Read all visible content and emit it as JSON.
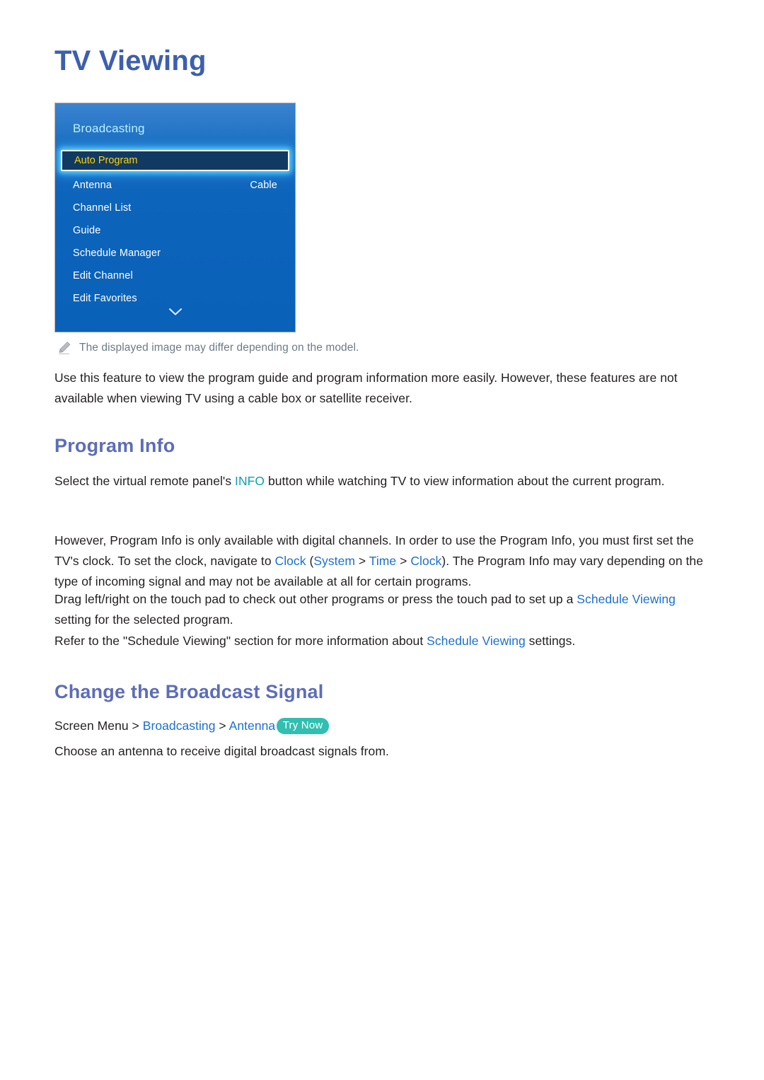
{
  "document": {
    "title": "TV Viewing"
  },
  "tv_menu": {
    "panel_title": "Broadcasting",
    "selected_item": "Auto Program",
    "items": [
      {
        "label": "Antenna",
        "value": "Cable"
      },
      {
        "label": "Channel List",
        "value": ""
      },
      {
        "label": "Guide",
        "value": ""
      },
      {
        "label": "Schedule Manager",
        "value": ""
      },
      {
        "label": "Edit Channel",
        "value": ""
      },
      {
        "label": "Edit Favorites",
        "value": ""
      }
    ],
    "scroll_down_icon": "chevron-down-icon",
    "colors": {
      "panel_gradient_top": "#3a83d0",
      "panel_gradient_bottom": "#0a61b8",
      "panel_title_text": "#b9f0ff",
      "selected_fill": "#113a63",
      "selected_text": "#ffd200",
      "selected_glow": "#5ad2ff"
    }
  },
  "note": {
    "icon": "pencil-icon",
    "text": "The displayed image may differ depending on the model."
  },
  "intro": {
    "line1": "Use this feature to view the program guide and program information more easily. However, these",
    "line2": "features are not available when viewing TV using a cable box or satellite receiver."
  },
  "program_info": {
    "heading": "Program Info",
    "p1_before": "Select the virtual remote panel's ",
    "p1_link": "INFO",
    "p1_after": " button while watching TV to view information about the current program.",
    "p2_before": "However, Program Info is only available with digital channels. In order to use the Program Info, you must first set the TV's clock. To set the clock, navigate to ",
    "p2_link_clock": "Clock",
    "p2_paren_open": " (",
    "p2_link_system": "System",
    "p2_sep_1": " > ",
    "p2_link_time": "Time",
    "p2_sep_2": " > ",
    "p2_link_clock2": "Clock",
    "p2_paren_close": ")",
    "p2_after": ". The Program Info may vary depending on the type of incoming signal and may not be available at all for certain programs.",
    "p3_before": "Drag left/right on the touch pad to check out other programs or press the touch pad to set up a ",
    "p3_link": "Schedule Viewing",
    "p3_after": " setting for the selected program.",
    "p4_before": "Refer to the \"Schedule Viewing\" section for more information about ",
    "p4_link": "Schedule Viewing",
    "p4_after": " settings."
  },
  "change_broadcast_signal": {
    "heading": "Change the Broadcast Signal",
    "breadcrumb_root": "Screen Menu",
    "breadcrumb_sep_1": " > ",
    "breadcrumb_item_1": "Broadcasting",
    "breadcrumb_sep_2": " > ",
    "breadcrumb_item_2": "Antenna",
    "try_now_badge": "Try Now",
    "body": "Choose an antenna to receive digital broadcast signals from."
  },
  "colors": {
    "title_blue": "#3d5fae",
    "heading_blue": "#5d6db8",
    "link_blue": "#1c6fd0",
    "link_teal": "#0a9fb5",
    "try_now_bg": "#30bfb0",
    "body_text": "#231f20",
    "note_text": "#6e7a86"
  }
}
